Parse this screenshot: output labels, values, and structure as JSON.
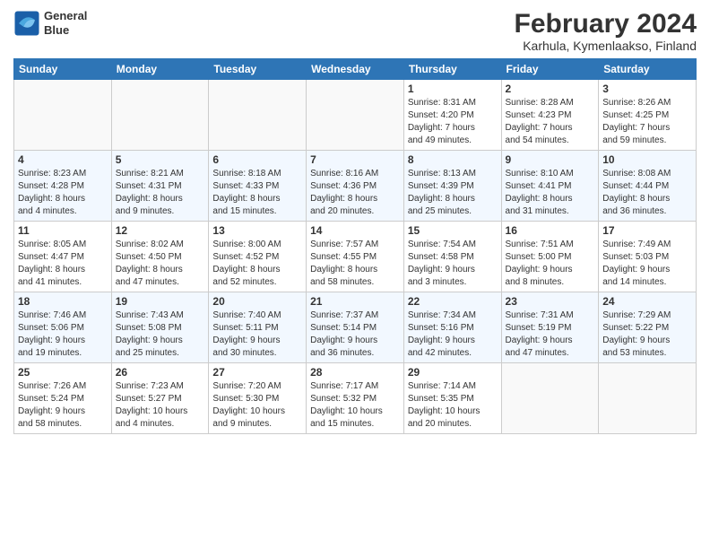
{
  "logo": {
    "line1": "General",
    "line2": "Blue"
  },
  "title": "February 2024",
  "subtitle": "Karhula, Kymenlaakso, Finland",
  "headers": [
    "Sunday",
    "Monday",
    "Tuesday",
    "Wednesday",
    "Thursday",
    "Friday",
    "Saturday"
  ],
  "weeks": [
    [
      {
        "day": "",
        "info": ""
      },
      {
        "day": "",
        "info": ""
      },
      {
        "day": "",
        "info": ""
      },
      {
        "day": "",
        "info": ""
      },
      {
        "day": "1",
        "info": "Sunrise: 8:31 AM\nSunset: 4:20 PM\nDaylight: 7 hours\nand 49 minutes."
      },
      {
        "day": "2",
        "info": "Sunrise: 8:28 AM\nSunset: 4:23 PM\nDaylight: 7 hours\nand 54 minutes."
      },
      {
        "day": "3",
        "info": "Sunrise: 8:26 AM\nSunset: 4:25 PM\nDaylight: 7 hours\nand 59 minutes."
      }
    ],
    [
      {
        "day": "4",
        "info": "Sunrise: 8:23 AM\nSunset: 4:28 PM\nDaylight: 8 hours\nand 4 minutes."
      },
      {
        "day": "5",
        "info": "Sunrise: 8:21 AM\nSunset: 4:31 PM\nDaylight: 8 hours\nand 9 minutes."
      },
      {
        "day": "6",
        "info": "Sunrise: 8:18 AM\nSunset: 4:33 PM\nDaylight: 8 hours\nand 15 minutes."
      },
      {
        "day": "7",
        "info": "Sunrise: 8:16 AM\nSunset: 4:36 PM\nDaylight: 8 hours\nand 20 minutes."
      },
      {
        "day": "8",
        "info": "Sunrise: 8:13 AM\nSunset: 4:39 PM\nDaylight: 8 hours\nand 25 minutes."
      },
      {
        "day": "9",
        "info": "Sunrise: 8:10 AM\nSunset: 4:41 PM\nDaylight: 8 hours\nand 31 minutes."
      },
      {
        "day": "10",
        "info": "Sunrise: 8:08 AM\nSunset: 4:44 PM\nDaylight: 8 hours\nand 36 minutes."
      }
    ],
    [
      {
        "day": "11",
        "info": "Sunrise: 8:05 AM\nSunset: 4:47 PM\nDaylight: 8 hours\nand 41 minutes."
      },
      {
        "day": "12",
        "info": "Sunrise: 8:02 AM\nSunset: 4:50 PM\nDaylight: 8 hours\nand 47 minutes."
      },
      {
        "day": "13",
        "info": "Sunrise: 8:00 AM\nSunset: 4:52 PM\nDaylight: 8 hours\nand 52 minutes."
      },
      {
        "day": "14",
        "info": "Sunrise: 7:57 AM\nSunset: 4:55 PM\nDaylight: 8 hours\nand 58 minutes."
      },
      {
        "day": "15",
        "info": "Sunrise: 7:54 AM\nSunset: 4:58 PM\nDaylight: 9 hours\nand 3 minutes."
      },
      {
        "day": "16",
        "info": "Sunrise: 7:51 AM\nSunset: 5:00 PM\nDaylight: 9 hours\nand 8 minutes."
      },
      {
        "day": "17",
        "info": "Sunrise: 7:49 AM\nSunset: 5:03 PM\nDaylight: 9 hours\nand 14 minutes."
      }
    ],
    [
      {
        "day": "18",
        "info": "Sunrise: 7:46 AM\nSunset: 5:06 PM\nDaylight: 9 hours\nand 19 minutes."
      },
      {
        "day": "19",
        "info": "Sunrise: 7:43 AM\nSunset: 5:08 PM\nDaylight: 9 hours\nand 25 minutes."
      },
      {
        "day": "20",
        "info": "Sunrise: 7:40 AM\nSunset: 5:11 PM\nDaylight: 9 hours\nand 30 minutes."
      },
      {
        "day": "21",
        "info": "Sunrise: 7:37 AM\nSunset: 5:14 PM\nDaylight: 9 hours\nand 36 minutes."
      },
      {
        "day": "22",
        "info": "Sunrise: 7:34 AM\nSunset: 5:16 PM\nDaylight: 9 hours\nand 42 minutes."
      },
      {
        "day": "23",
        "info": "Sunrise: 7:31 AM\nSunset: 5:19 PM\nDaylight: 9 hours\nand 47 minutes."
      },
      {
        "day": "24",
        "info": "Sunrise: 7:29 AM\nSunset: 5:22 PM\nDaylight: 9 hours\nand 53 minutes."
      }
    ],
    [
      {
        "day": "25",
        "info": "Sunrise: 7:26 AM\nSunset: 5:24 PM\nDaylight: 9 hours\nand 58 minutes."
      },
      {
        "day": "26",
        "info": "Sunrise: 7:23 AM\nSunset: 5:27 PM\nDaylight: 10 hours\nand 4 minutes."
      },
      {
        "day": "27",
        "info": "Sunrise: 7:20 AM\nSunset: 5:30 PM\nDaylight: 10 hours\nand 9 minutes."
      },
      {
        "day": "28",
        "info": "Sunrise: 7:17 AM\nSunset: 5:32 PM\nDaylight: 10 hours\nand 15 minutes."
      },
      {
        "day": "29",
        "info": "Sunrise: 7:14 AM\nSunset: 5:35 PM\nDaylight: 10 hours\nand 20 minutes."
      },
      {
        "day": "",
        "info": ""
      },
      {
        "day": "",
        "info": ""
      }
    ]
  ]
}
